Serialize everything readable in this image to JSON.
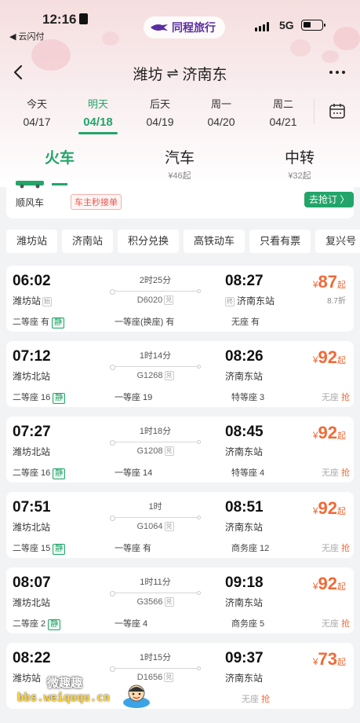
{
  "status_bar": {
    "time": "12:16",
    "back_app": "◀ 云闪付",
    "app_brand": "同程旅行",
    "network": "5G"
  },
  "nav": {
    "from": "潍坊",
    "swap_symbol": "⇌",
    "to": "济南东"
  },
  "dates": [
    {
      "weekday": "今天",
      "date": "04/17",
      "active": false
    },
    {
      "weekday": "明天",
      "date": "04/18",
      "active": true
    },
    {
      "weekday": "后天",
      "date": "04/19",
      "active": false
    },
    {
      "weekday": "周一",
      "date": "04/20",
      "active": false
    },
    {
      "weekday": "周二",
      "date": "04/21",
      "active": false
    }
  ],
  "modes": [
    {
      "name": "火车",
      "price": "",
      "active": true
    },
    {
      "name": "汽车",
      "price": "¥46起",
      "active": false
    },
    {
      "name": "中转",
      "price": "¥32起",
      "active": false
    }
  ],
  "ride": {
    "label": "顺风车",
    "tag": "车主秒接单",
    "button": "去抢订 〉"
  },
  "filters": [
    "潍坊站",
    "济南站",
    "积分兑换",
    "高铁动车",
    "只看有票",
    "复兴号"
  ],
  "trains": [
    {
      "dep_time": "06:02",
      "dep_station": "潍坊站",
      "dep_tag": "始",
      "duration": "2时25分",
      "code": "D6020",
      "code_tag": "兑",
      "arr_time": "08:27",
      "arr_tag": "终",
      "arr_station": "济南东站",
      "price_sym": "¥",
      "price": "87",
      "price_suffix": "起",
      "discount": "8.7折",
      "seat1": "二等座 有",
      "seat1_quiet": "静",
      "seat2": "一等座(换座) 有",
      "seat3": "无座 有",
      "seat4": "",
      "seat4_grab": ""
    },
    {
      "dep_time": "07:12",
      "dep_station": "潍坊北站",
      "dep_tag": "",
      "duration": "1时14分",
      "code": "G1268",
      "code_tag": "兑",
      "arr_time": "08:26",
      "arr_tag": "",
      "arr_station": "济南东站",
      "price_sym": "¥",
      "price": "92",
      "price_suffix": "起",
      "discount": "",
      "seat1": "二等座 16",
      "seat1_quiet": "静",
      "seat2": "一等座 19",
      "seat3": "特等座 3",
      "seat4": "无座",
      "seat4_grab": "抢"
    },
    {
      "dep_time": "07:27",
      "dep_station": "潍坊北站",
      "dep_tag": "",
      "duration": "1时18分",
      "code": "G1208",
      "code_tag": "兑",
      "arr_time": "08:45",
      "arr_tag": "",
      "arr_station": "济南东站",
      "price_sym": "¥",
      "price": "92",
      "price_suffix": "起",
      "discount": "",
      "seat1": "二等座 16",
      "seat1_quiet": "静",
      "seat2": "一等座 14",
      "seat3": "特等座 4",
      "seat4": "无座",
      "seat4_grab": "抢"
    },
    {
      "dep_time": "07:51",
      "dep_station": "潍坊北站",
      "dep_tag": "",
      "duration": "1时",
      "code": "G1064",
      "code_tag": "兑",
      "arr_time": "08:51",
      "arr_tag": "",
      "arr_station": "济南东站",
      "price_sym": "¥",
      "price": "92",
      "price_suffix": "起",
      "discount": "",
      "seat1": "二等座 15",
      "seat1_quiet": "静",
      "seat2": "一等座 有",
      "seat3": "商务座 12",
      "seat4": "无座",
      "seat4_grab": "抢"
    },
    {
      "dep_time": "08:07",
      "dep_station": "潍坊北站",
      "dep_tag": "",
      "duration": "1时11分",
      "code": "G3566",
      "code_tag": "兑",
      "arr_time": "09:18",
      "arr_tag": "",
      "arr_station": "济南东站",
      "price_sym": "¥",
      "price": "92",
      "price_suffix": "起",
      "discount": "",
      "seat1": "二等座 2",
      "seat1_quiet": "静",
      "seat2": "一等座 4",
      "seat3": "商务座 5",
      "seat4": "无座",
      "seat4_grab": "抢"
    },
    {
      "dep_time": "08:22",
      "dep_station": "潍坊站",
      "dep_tag": "",
      "duration": "1时15分",
      "code": "D1656",
      "code_tag": "兑",
      "arr_time": "09:37",
      "arr_tag": "",
      "arr_station": "济南东站",
      "price_sym": "¥",
      "price": "73",
      "price_suffix": "起",
      "discount": "",
      "seat1": "",
      "seat1_quiet": "",
      "seat2": "",
      "seat3": "无座",
      "seat3_grab": "抢",
      "seat4": "",
      "seat4_grab": ""
    }
  ],
  "watermark": {
    "line1": "微趣趣",
    "line2": "bbs.weiququ.cn"
  },
  "colors": {
    "accent": "#23a56a",
    "price": "#f06a37",
    "brand": "#5a2ea0"
  }
}
